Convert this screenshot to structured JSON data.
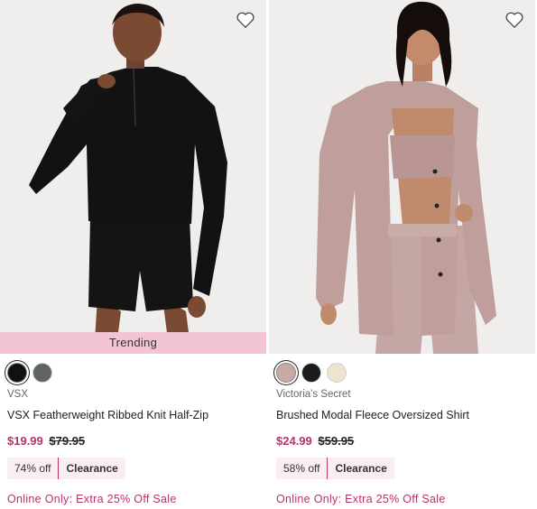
{
  "colors": {
    "sale": "#b4336b",
    "trending_bg": "#f3c4d4",
    "badge_bg": "#fbeef2"
  },
  "products": [
    {
      "badge_overlay": "Trending",
      "swatches": [
        {
          "color": "#111111",
          "selected": true
        },
        {
          "color": "#5e6466",
          "selected": false
        }
      ],
      "brand": "VSX",
      "name": "VSX Featherweight Ribbed Knit Half-Zip",
      "sale_price": "$19.99",
      "original_price": "$79.95",
      "discount": "74% off",
      "clearance": "Clearance",
      "promo": "Online Only: Extra 25% Off Sale",
      "wishlist_icon": "heart-outline-icon"
    },
    {
      "swatches": [
        {
          "color": "#c9a9a6",
          "selected": true
        },
        {
          "color": "#1b1b1b",
          "selected": false
        },
        {
          "color": "#efe3cf",
          "selected": false
        }
      ],
      "brand": "Victoria's Secret",
      "name": "Brushed Modal Fleece Oversized Shirt",
      "sale_price": "$24.99",
      "original_price": "$59.95",
      "discount": "58% off",
      "clearance": "Clearance",
      "promo": "Online Only: Extra 25% Off Sale",
      "wishlist_icon": "heart-outline-icon"
    }
  ]
}
